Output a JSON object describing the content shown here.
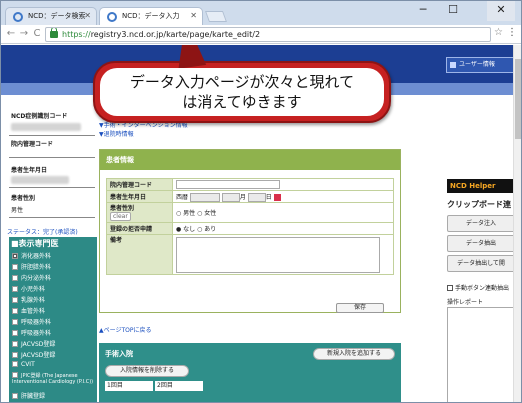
{
  "browser": {
    "tabs": [
      {
        "label": "NCD：データ検索"
      },
      {
        "label": "NCD：データ入力"
      }
    ],
    "url_https": "https://",
    "url_rest": "registry3.ncd.or.jp/karte/page/karte_edit/2",
    "window_controls": {
      "minimize": "─",
      "maximize": "☐",
      "close": "✕"
    },
    "nav": {
      "back": "←",
      "forward": "→",
      "reload": "C"
    }
  },
  "header": {
    "user_info": "ユーザー情報"
  },
  "callout": {
    "line1": "データ入力ページが次々と現れて",
    "line2": "は消えてゆきます"
  },
  "left": {
    "case_id_label": "NCD症例識別コード",
    "hospital_code_label": "院内管理コード",
    "birthdate_label": "患者生年月日",
    "sex_label": "患者性別",
    "sex_value": "男性",
    "status": "ステータス：完了(承認済)",
    "dept_header": "■表示専門医",
    "departments": [
      "消化器外科",
      "肝胆膵外科",
      "内分泌外科",
      "小児外科",
      "乳腺外科",
      "血管外科",
      "呼吸器外科",
      "呼吸器外科",
      "JACVSD登録",
      "JACVSD登録",
      "CVIT",
      "JPIC登録 (The Japanese Interventional Cardiology (P.I.C))",
      "肝臓登録"
    ]
  },
  "center": {
    "links": [
      "▼手術・インターベンション情報",
      "▼退院時情報"
    ],
    "patient_panel_title": "患者情報",
    "fields": {
      "hospital_code": "院内管理コード",
      "birthdate": "患者生年月日",
      "birthdate_era": "西暦",
      "month_suffix": "月",
      "day_suffix": "日",
      "sex": "患者性別",
      "sex_clear": "clear",
      "sex_male": "男性",
      "sex_female": "女性",
      "refusal": "登録の拒否申請",
      "refusal_none": "なし",
      "refusal_yes": "あり",
      "notes": "備考"
    },
    "save_button": "保存",
    "page_top": "▲ページTOPに戻る",
    "operation_panel_title": "手術入院",
    "new_admission_button": "新規入院を追加する",
    "delete_admission_button": "入院情報を削除する",
    "admission_tabs": [
      "1回目",
      "2回目"
    ]
  },
  "helper": {
    "title": "NCD Helper",
    "clipboard_title": "クリップボード連",
    "buttons": [
      "データ注入",
      "データ抽出",
      "データ抽出して開"
    ],
    "manual_link": "手動ボタン連動抽出",
    "report_label": "操作レポート"
  }
}
